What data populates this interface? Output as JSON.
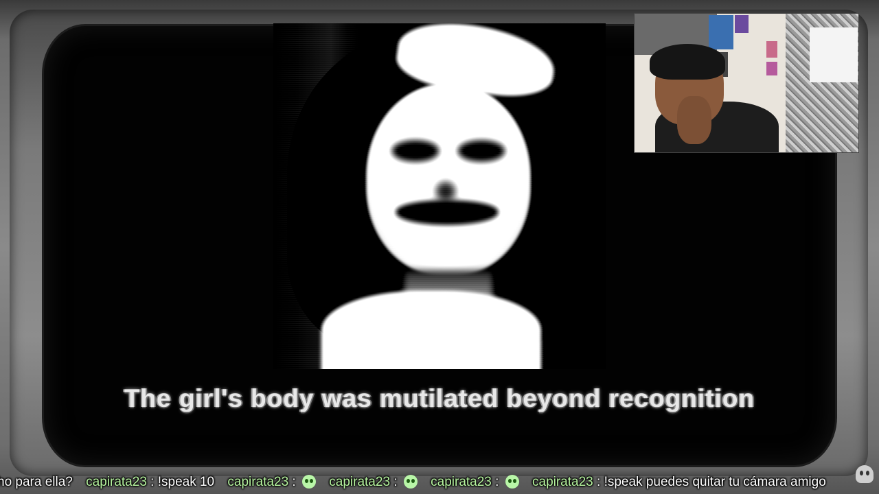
{
  "stream": {
    "caption": "The girl's body was mutilated beyond recognition"
  },
  "webcam": {
    "label": ""
  },
  "chat_ticker": {
    "lead_text": "ho para ella?",
    "messages": [
      {
        "user": "capirata23",
        "separator": " : ",
        "text": "!speak 10",
        "emote": ""
      },
      {
        "user": "capirata23",
        "separator": " : ",
        "text": "",
        "emote": "green-ghost-emote"
      },
      {
        "user": "capirata23",
        "separator": " : ",
        "text": "",
        "emote": "green-ghost-emote"
      },
      {
        "user": "capirata23",
        "separator": " : ",
        "text": "",
        "emote": "green-ghost-emote"
      },
      {
        "user": "capirata23",
        "separator": " : ",
        "text": "!speak puedes quitar tu cámara amigo",
        "emote": ""
      }
    ]
  },
  "colors": {
    "username": "#b7f5a0",
    "chat_text": "#ffffff",
    "screen_bg": "#020202"
  }
}
